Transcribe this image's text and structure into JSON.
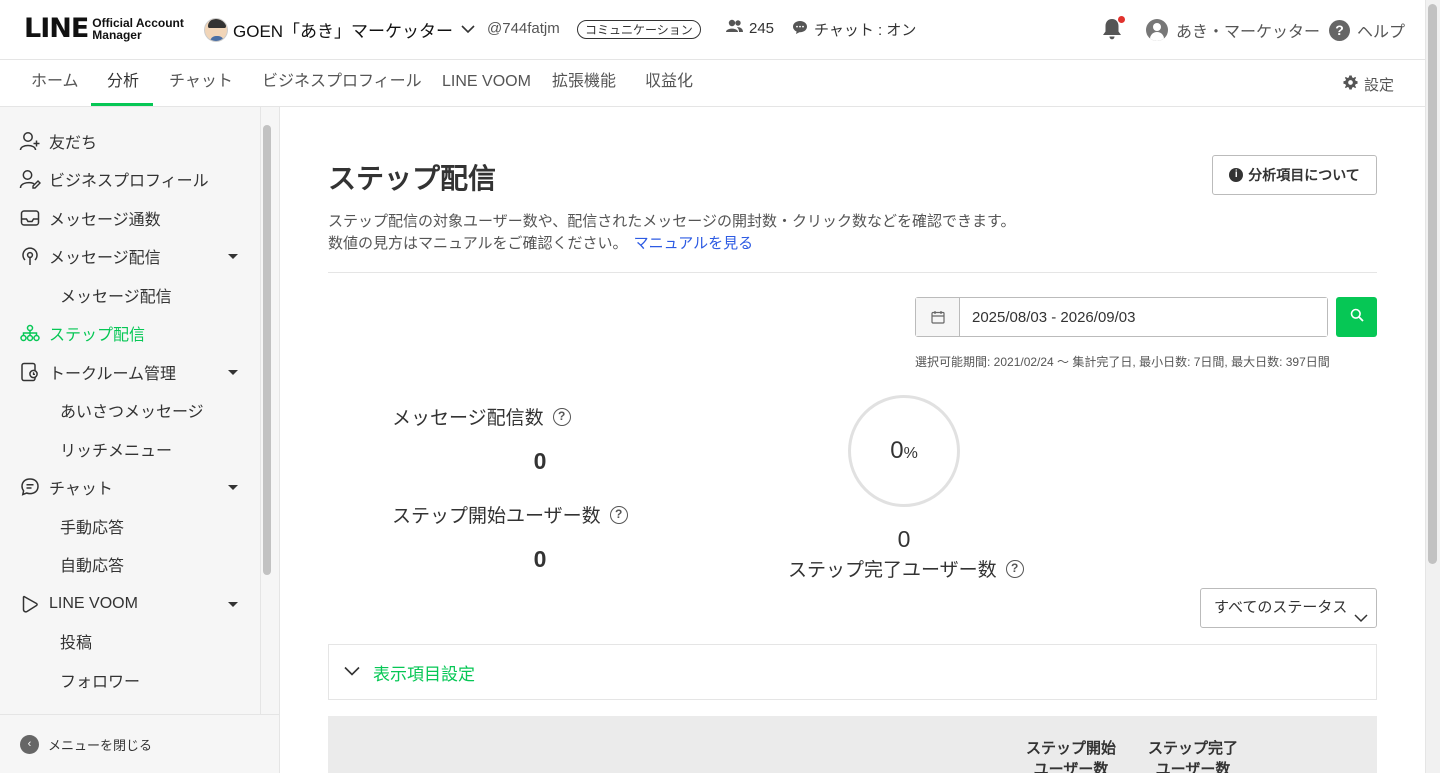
{
  "header": {
    "logo_text": "LINE",
    "logo_sub1": "Official Account",
    "logo_sub2": "Manager",
    "account_name": "GOEN「あき」マーケッター",
    "account_id": "@744fatjm",
    "account_badge": "コミュニケーション",
    "friends_count": "245",
    "chat_status": "チャット : オン",
    "user_name": "あき・マーケッター",
    "help_label": "ヘルプ",
    "notification_dot_color": "#e1322d"
  },
  "nav": {
    "tabs": [
      {
        "label": "ホーム"
      },
      {
        "label": "分析"
      },
      {
        "label": "チャット"
      },
      {
        "label": "ビジネスプロフィール"
      },
      {
        "label": "LINE VOOM"
      },
      {
        "label": "拡張機能"
      },
      {
        "label": "収益化"
      }
    ],
    "active_tab": "分析",
    "settings_label": "設定"
  },
  "sidebar": {
    "items": [
      {
        "label": "友だち",
        "icon": "add-friend-icon"
      },
      {
        "label": "ビジネスプロフィール",
        "icon": "profile-icon"
      },
      {
        "label": "メッセージ通数",
        "icon": "inbox-icon"
      },
      {
        "label": "メッセージ配信",
        "icon": "broadcast-icon"
      },
      {
        "label": "メッセージ配信"
      },
      {
        "label": "ステップ配信",
        "icon": "step-icon"
      },
      {
        "label": "トークルーム管理",
        "icon": "talkroom-icon"
      },
      {
        "label": "あいさつメッセージ"
      },
      {
        "label": "リッチメニュー"
      },
      {
        "label": "チャット",
        "icon": "chat-icon"
      },
      {
        "label": "手動応答"
      },
      {
        "label": "自動応答"
      },
      {
        "label": "LINE VOOM",
        "icon": "voom-icon"
      },
      {
        "label": "投稿"
      },
      {
        "label": "フォロワー"
      }
    ],
    "active_item": "ステップ配信",
    "close_label": "メニューを閉じる"
  },
  "main": {
    "title": "ステップ配信",
    "about_button": "分析項目について",
    "description_line1": "ステップ配信の対象ユーザー数や、配信されたメッセージの開封数・クリック数などを確認できます。",
    "description_line2": "数値の見方はマニュアルをご確認ください。",
    "manual_link": "マニュアルを見る",
    "date_range": "2025/08/03 - 2026/09/03",
    "range_note": "選択可能期間: 2021/02/24 〜 集計完了日, 最小日数: 7日間, 最大日数: 397日間",
    "stats": {
      "message_count_label": "メッセージ配信数",
      "message_count_value": "0",
      "step_start_label": "ステップ開始ユーザー数",
      "step_start_value": "0",
      "completion_rate": "0",
      "completion_unit": "%",
      "completion_fraction": 0,
      "step_complete_value": "0",
      "step_complete_label": "ステップ完了ユーザー数"
    },
    "status_filter": "すべてのステータス",
    "display_settings_label": "表示項目設定",
    "table_headers": {
      "step_start": [
        "ステップ開始",
        "ユーザー数"
      ],
      "step_complete": [
        "ステップ完了",
        "ユーザー数"
      ]
    }
  },
  "colors": {
    "accent": "#06c755",
    "link": "#2d5be3"
  }
}
